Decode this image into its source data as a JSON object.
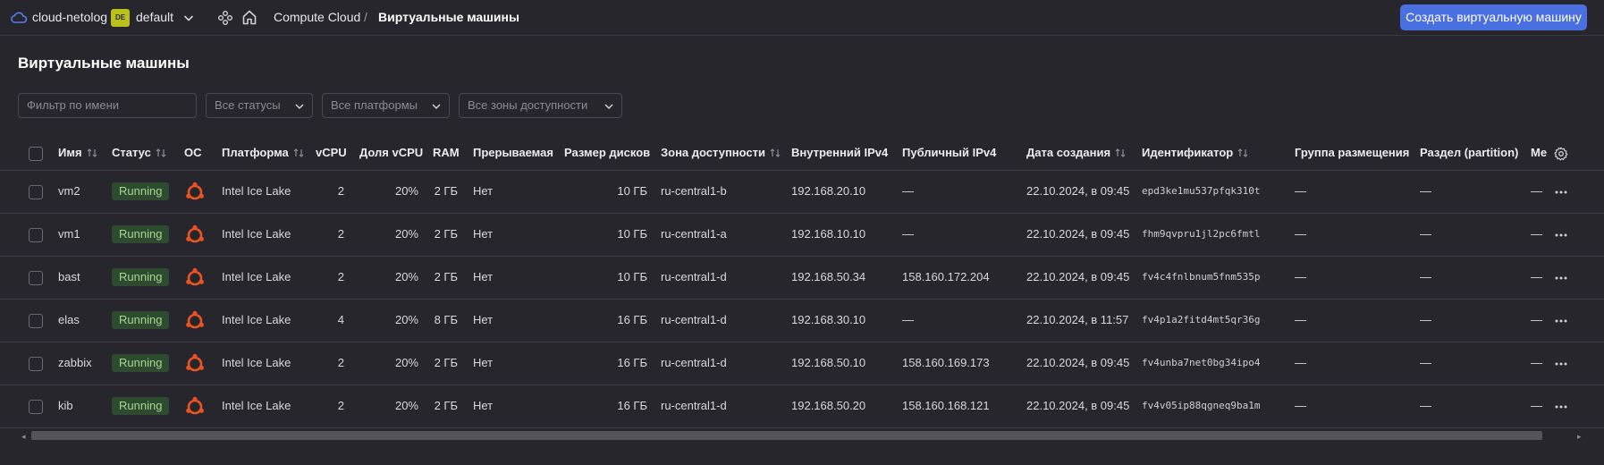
{
  "topbar": {
    "cloud_name": "cloud-netolog",
    "folder_badge": "DE",
    "folder_name": "default",
    "breadcrumb": [
      "Compute Cloud",
      "Виртуальные машины"
    ],
    "breadcrumb_sep": "/",
    "create_button": "Создать виртуальную машину"
  },
  "page": {
    "title": "Виртуальные машины"
  },
  "filters": {
    "name_placeholder": "Фильтр по имени",
    "status": "Все статусы",
    "platform": "Все платформы",
    "zone": "Все зоны доступности"
  },
  "table": {
    "headers": {
      "name": "Имя",
      "status": "Статус",
      "os": "ОС",
      "platform": "Платформа",
      "vcpu": "vCPU",
      "vcpu_share": "Доля vCPU",
      "ram": "RAM",
      "preemptible": "Прерываемая",
      "disk": "Размер дисков",
      "zone": "Зона доступности",
      "internal_ip": "Внутренний IPv4",
      "public_ip": "Публичный IPv4",
      "created": "Дата создания",
      "id": "Идентификатор",
      "placement": "Группа размещения",
      "partition": "Раздел (partition)",
      "more": "Ме"
    },
    "rows": [
      {
        "name": "vm2",
        "status": "Running",
        "platform": "Intel Ice Lake",
        "vcpu": "2",
        "share": "20%",
        "ram": "2 ГБ",
        "preemptible": "Нет",
        "disk": "10 ГБ",
        "zone": "ru-central1-b",
        "internal_ip": "192.168.20.10",
        "public_ip": "—",
        "created": "22.10.2024, в 09:45",
        "id": "epd3ke1mu537pfqk310t",
        "placement": "—",
        "partition": "—",
        "more": "—"
      },
      {
        "name": "vm1",
        "status": "Running",
        "platform": "Intel Ice Lake",
        "vcpu": "2",
        "share": "20%",
        "ram": "2 ГБ",
        "preemptible": "Нет",
        "disk": "10 ГБ",
        "zone": "ru-central1-a",
        "internal_ip": "192.168.10.10",
        "public_ip": "—",
        "created": "22.10.2024, в 09:45",
        "id": "fhm9qvpru1jl2pc6fmtl",
        "placement": "—",
        "partition": "—",
        "more": "—"
      },
      {
        "name": "bast",
        "status": "Running",
        "platform": "Intel Ice Lake",
        "vcpu": "2",
        "share": "20%",
        "ram": "2 ГБ",
        "preemptible": "Нет",
        "disk": "10 ГБ",
        "zone": "ru-central1-d",
        "internal_ip": "192.168.50.34",
        "public_ip": "158.160.172.204",
        "created": "22.10.2024, в 09:45",
        "id": "fv4c4fnlbnum5fnm535p",
        "placement": "—",
        "partition": "—",
        "more": "—"
      },
      {
        "name": "elas",
        "status": "Running",
        "platform": "Intel Ice Lake",
        "vcpu": "4",
        "share": "20%",
        "ram": "8 ГБ",
        "preemptible": "Нет",
        "disk": "16 ГБ",
        "zone": "ru-central1-d",
        "internal_ip": "192.168.30.10",
        "public_ip": "—",
        "created": "22.10.2024, в 11:57",
        "id": "fv4p1a2fitd4mt5qr36g",
        "placement": "—",
        "partition": "—",
        "more": "—"
      },
      {
        "name": "zabbix",
        "status": "Running",
        "platform": "Intel Ice Lake",
        "vcpu": "2",
        "share": "20%",
        "ram": "2 ГБ",
        "preemptible": "Нет",
        "disk": "16 ГБ",
        "zone": "ru-central1-d",
        "internal_ip": "192.168.50.10",
        "public_ip": "158.160.169.173",
        "created": "22.10.2024, в 09:45",
        "id": "fv4unba7net0bg34ipo4",
        "placement": "—",
        "partition": "—",
        "more": "—"
      },
      {
        "name": "kib",
        "status": "Running",
        "platform": "Intel Ice Lake",
        "vcpu": "2",
        "share": "20%",
        "ram": "2 ГБ",
        "preemptible": "Нет",
        "disk": "16 ГБ",
        "zone": "ru-central1-d",
        "internal_ip": "192.168.50.20",
        "public_ip": "158.160.168.121",
        "created": "22.10.2024, в 09:45",
        "id": "fv4v05ip88qgneq9ba1m",
        "placement": "—",
        "partition": "—",
        "more": "—"
      }
    ]
  },
  "colors": {
    "background": "#27262d",
    "accent": "#4a6fe0",
    "status_running_bg": "#2e4a2f",
    "status_running_text": "#a3d98f",
    "ubuntu": "#e95420",
    "folder_badge": "#b9c11a"
  },
  "icons": {
    "cloud": "cloud-icon",
    "chevron": "chevron-down-icon",
    "services": "services-icon",
    "home": "home-icon",
    "sort": "sort-icon",
    "os": "ubuntu-icon",
    "row_actions": "more-dots-icon",
    "settings": "gear-icon"
  }
}
